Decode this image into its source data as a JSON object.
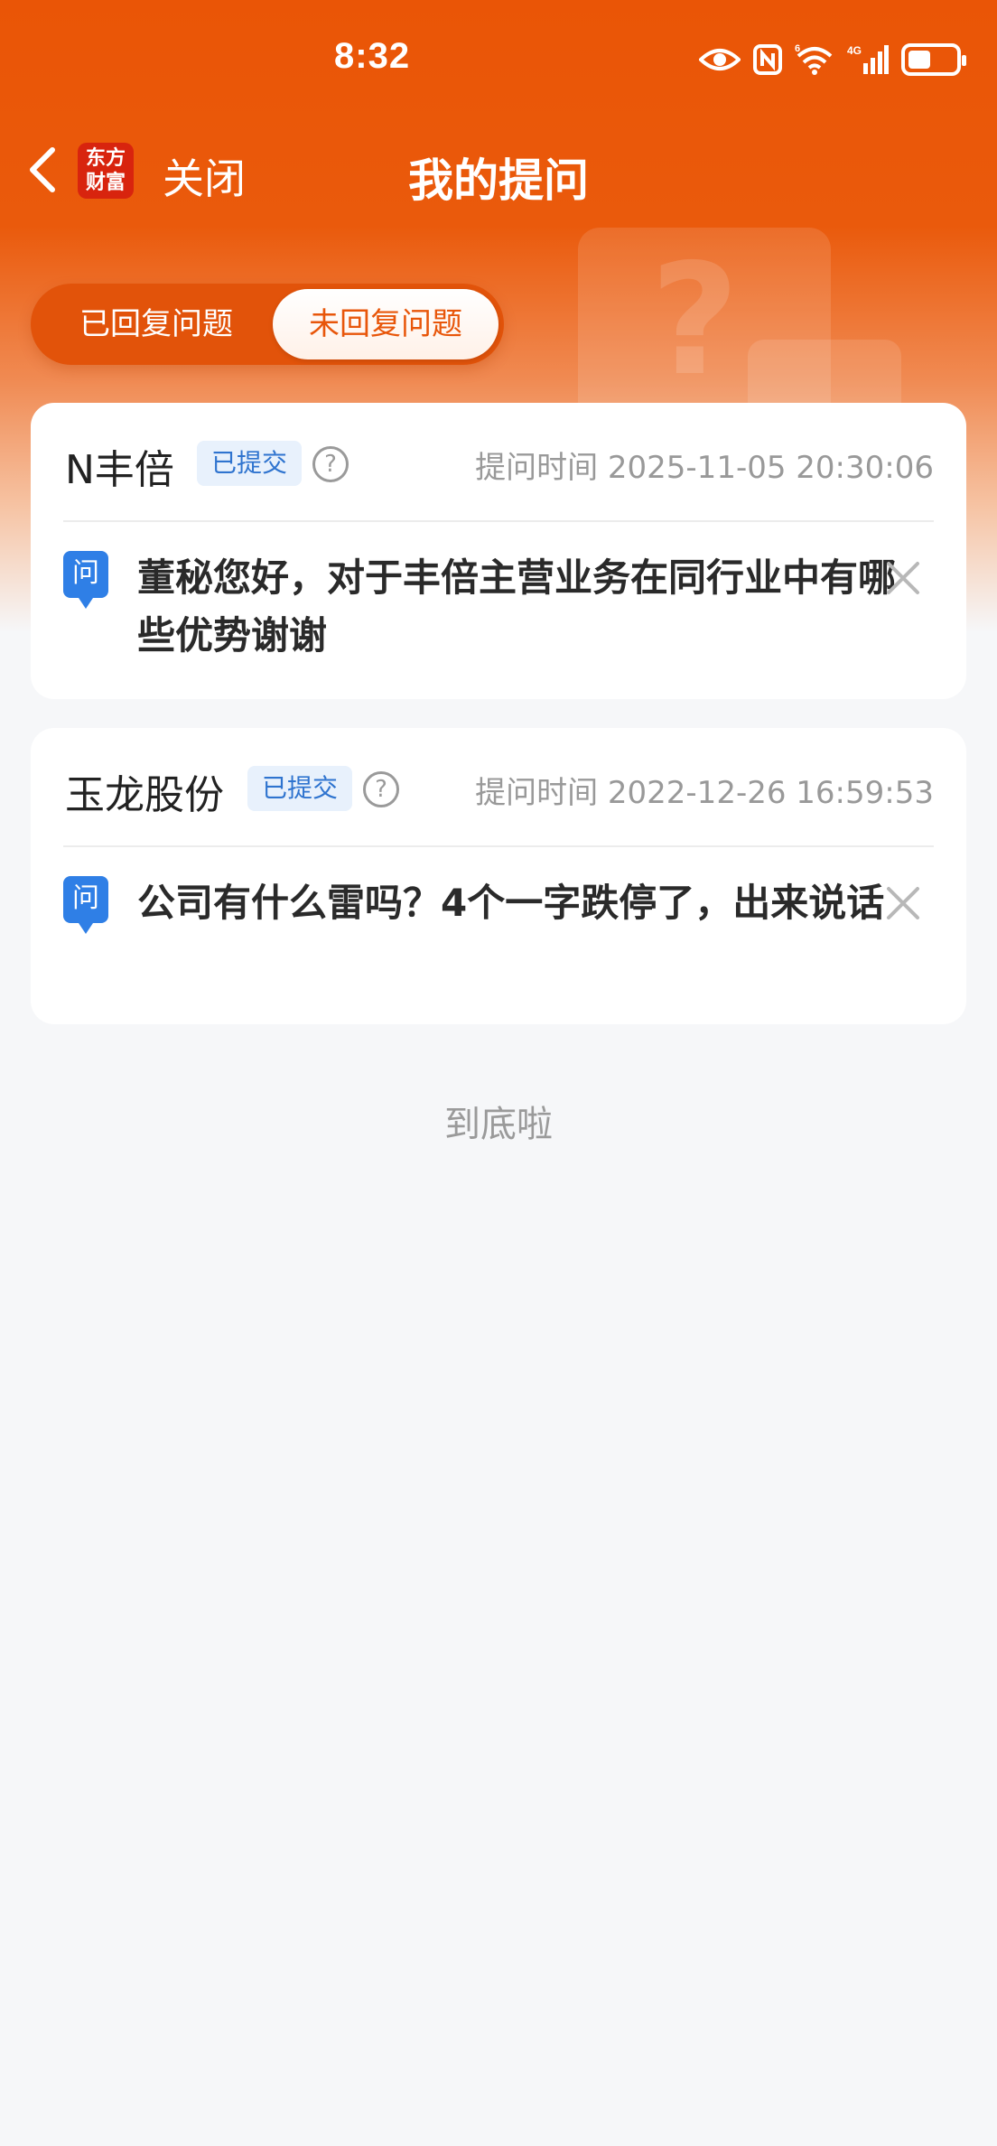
{
  "status_bar": {
    "time": "8:32",
    "icons": [
      "eye-icon",
      "nfc-icon",
      "wifi-icon",
      "signal-4g-icon",
      "battery-icon"
    ],
    "network_label": "4G",
    "wifi_label": "6"
  },
  "nav": {
    "logo_line1": "东方",
    "logo_line2": "财富",
    "close_label": "关闭",
    "title": "我的提问"
  },
  "tabs": {
    "answered_label": "已回复问题",
    "unanswered_label": "未回复问题",
    "active": "unanswered"
  },
  "questions": [
    {
      "company": "N丰倍",
      "status": "已提交",
      "time": "提问时间 2025-11-05 20:30:06",
      "icon_label": "问",
      "text": "董秘您好，对于丰倍主营业务在同行业中有哪些优势谢谢"
    },
    {
      "company": "玉龙股份",
      "status": "已提交",
      "time": "提问时间 2022-12-26 16:59:53",
      "icon_label": "问",
      "text": "公司有什么雷吗？4个一字跌停了，出来说话"
    }
  ],
  "footer": {
    "end_text": "到底啦"
  },
  "colors": {
    "brand_orange": "#ea5506",
    "badge_blue": "#2f74cf",
    "question_icon_blue": "#2f7fe6",
    "background": "#f6f7f9"
  }
}
